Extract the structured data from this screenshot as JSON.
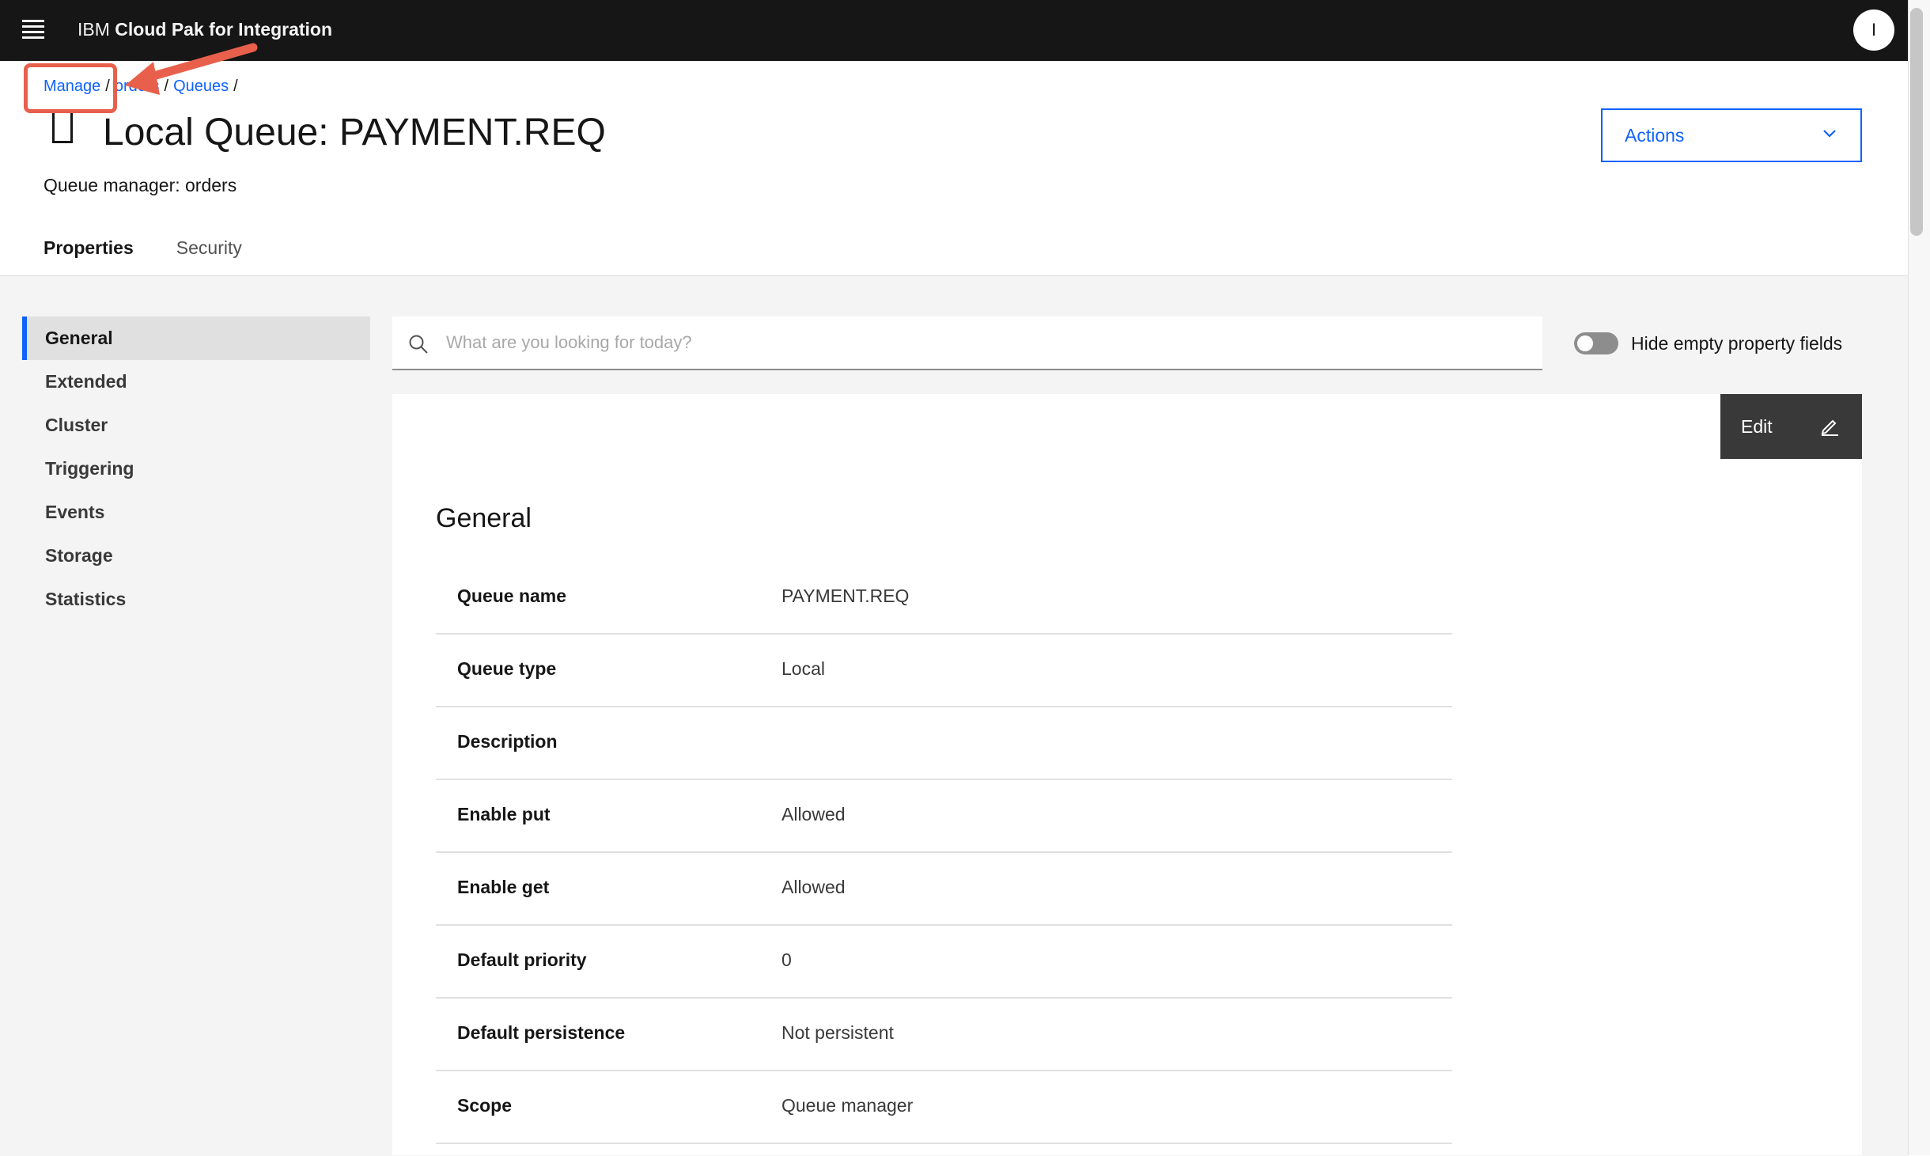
{
  "header": {
    "brand_prefix": "IBM",
    "brand_name": "Cloud Pak for Integration",
    "user_initial": "I"
  },
  "breadcrumb": {
    "items": [
      "Manage",
      "orders",
      "Queues"
    ],
    "separator": "/"
  },
  "page": {
    "title": "Local Queue: PAYMENT.REQ",
    "subtitle": "Queue manager: orders",
    "actions_label": "Actions"
  },
  "tabs": [
    {
      "label": "Properties",
      "active": true
    },
    {
      "label": "Security",
      "active": false
    }
  ],
  "sidenav": {
    "items": [
      "General",
      "Extended",
      "Cluster",
      "Triggering",
      "Events",
      "Storage",
      "Statistics"
    ],
    "active": "General"
  },
  "search": {
    "placeholder": "What are you looking for today?"
  },
  "toggle": {
    "label": "Hide empty property fields",
    "on": false
  },
  "panel": {
    "edit_label": "Edit",
    "section_title": "General",
    "properties": [
      {
        "key": "Queue name",
        "value": "PAYMENT.REQ"
      },
      {
        "key": "Queue type",
        "value": "Local"
      },
      {
        "key": "Description",
        "value": ""
      },
      {
        "key": "Enable put",
        "value": "Allowed"
      },
      {
        "key": "Enable get",
        "value": "Allowed"
      },
      {
        "key": "Default priority",
        "value": "0"
      },
      {
        "key": "Default persistence",
        "value": "Not persistent"
      },
      {
        "key": "Scope",
        "value": "Queue manager"
      }
    ]
  },
  "annotation": {
    "color": "#e8604c"
  }
}
